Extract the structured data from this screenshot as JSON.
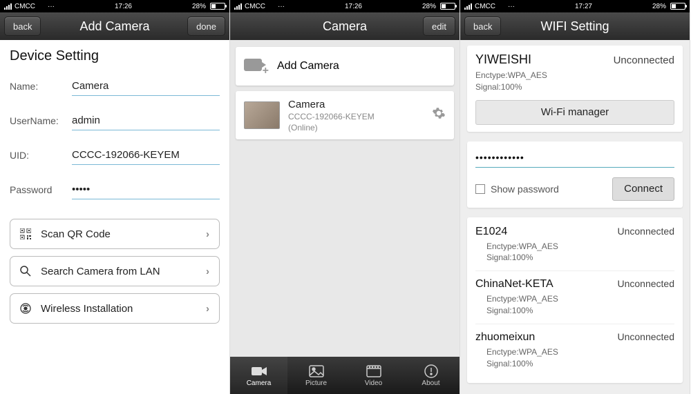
{
  "status": {
    "carrier": "CMCC",
    "dots": "···",
    "battery_pct": "28%"
  },
  "screen1": {
    "status_time": "17:26",
    "nav": {
      "back": "back",
      "title": "Add Camera",
      "done": "done"
    },
    "section_title": "Device Setting",
    "fields": {
      "name_label": "Name:",
      "name_value": "Camera",
      "username_label": "UserName:",
      "username_value": "admin",
      "uid_label": "UID:",
      "uid_value": "CCCC-192066-KEYEM",
      "password_label": "Password",
      "password_value": "•••••"
    },
    "options": {
      "qr": "Scan QR Code",
      "lan": "Search Camera from LAN",
      "wireless": "Wireless Installation"
    }
  },
  "screen2": {
    "status_time": "17:26",
    "nav": {
      "title": "Camera",
      "edit": "edit"
    },
    "add_label": "Add Camera",
    "camera": {
      "name": "Camera",
      "uid": "CCCC-192066-KEYEM",
      "status": "(Online)"
    },
    "tabs": {
      "camera": "Camera",
      "picture": "Picture",
      "video": "Video",
      "about": "About"
    }
  },
  "screen3": {
    "status_time": "17:27",
    "nav": {
      "back": "back",
      "title": "WIFI Setting"
    },
    "current": {
      "ssid": "YIWEISHI",
      "state": "Unconnected",
      "enctype": "Enctype:WPA_AES",
      "signal": "Signal:100%",
      "manager": "Wi-Fi manager"
    },
    "password_mask": "••••••••••••",
    "show_password": "Show password",
    "connect": "Connect",
    "networks": [
      {
        "ssid": "E1024",
        "state": "Unconnected",
        "enctype": "Enctype:WPA_AES",
        "signal": "Signal:100%"
      },
      {
        "ssid": "ChinaNet-KETA",
        "state": "Unconnected",
        "enctype": "Enctype:WPA_AES",
        "signal": "Signal:100%"
      },
      {
        "ssid": "zhuomeixun",
        "state": "Unconnected",
        "enctype": "Enctype:WPA_AES",
        "signal": "Signal:100%"
      }
    ]
  }
}
